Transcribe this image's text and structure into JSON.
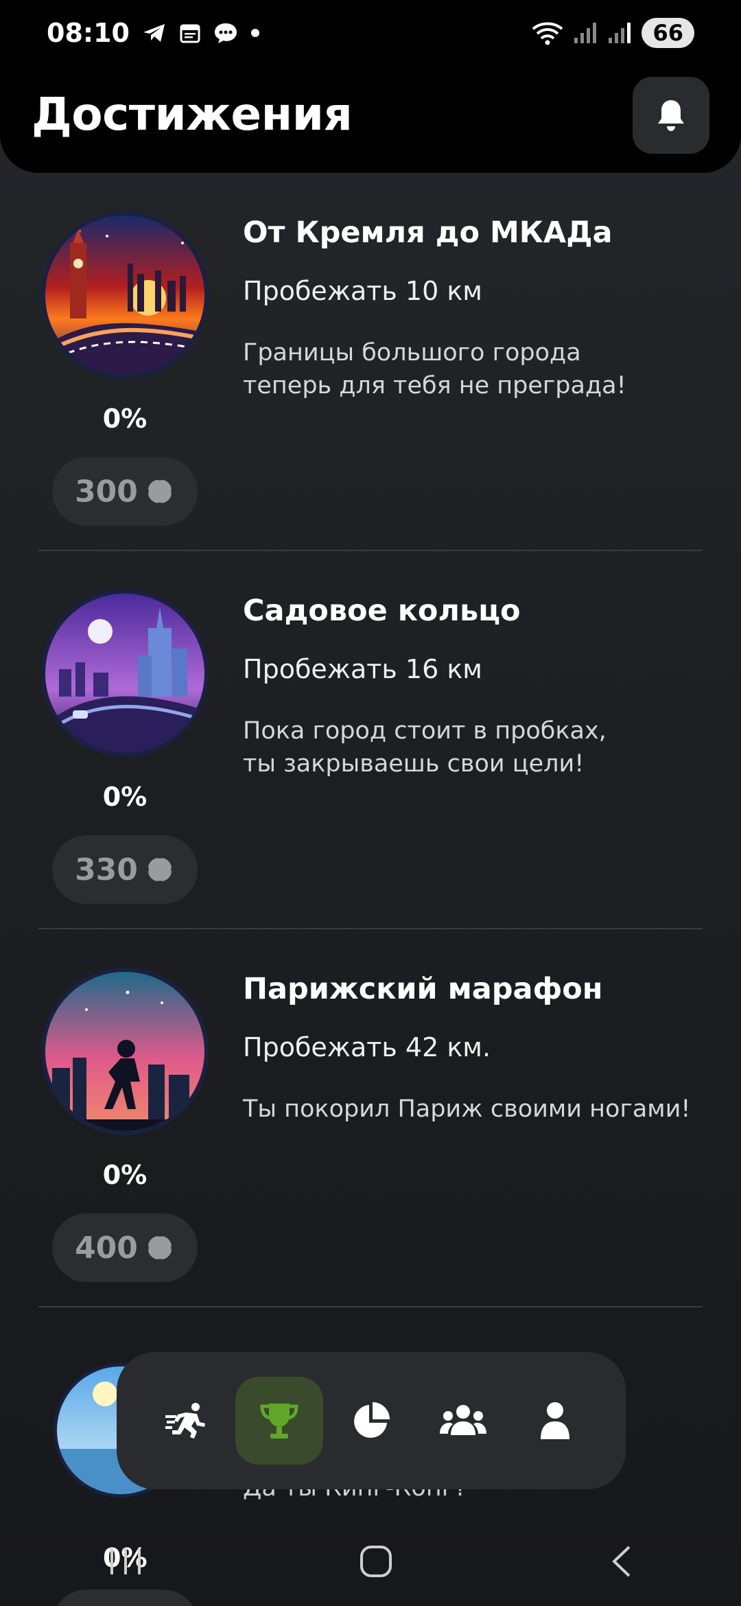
{
  "status_bar": {
    "time": "08:10",
    "battery": "66"
  },
  "header": {
    "title": "Достижения"
  },
  "achievements": [
    {
      "title": "От Кремля до МКАДа",
      "goal": "Пробежать 10 км",
      "description": "Границы большого города\nтеперь для тебя не преграда!",
      "progress": "0%",
      "reward": "300"
    },
    {
      "title": "Садовое кольцо",
      "goal": "Пробежать 16 км",
      "description": "Пока город стоит в пробках,\nты закрываешь свои цели!",
      "progress": "0%",
      "reward": "330"
    },
    {
      "title": "Парижский марафон",
      "goal": "Пробежать 42 км.",
      "description": "Ты покорил Париж своими ногами!",
      "progress": "0%",
      "reward": "400"
    }
  ],
  "partial_item": {
    "description": "Да ты Кинг-Конг?",
    "progress": "0%"
  },
  "tabs": [
    {
      "icon": "running-icon",
      "active": false
    },
    {
      "icon": "trophy-icon",
      "active": true
    },
    {
      "icon": "pie-chart-icon",
      "active": false
    },
    {
      "icon": "group-icon",
      "active": false
    },
    {
      "icon": "profile-icon",
      "active": false
    }
  ],
  "colors": {
    "accent_green": "#5fa82a",
    "active_tab_bg": "#3a4a2c",
    "background": "#1f2124"
  }
}
